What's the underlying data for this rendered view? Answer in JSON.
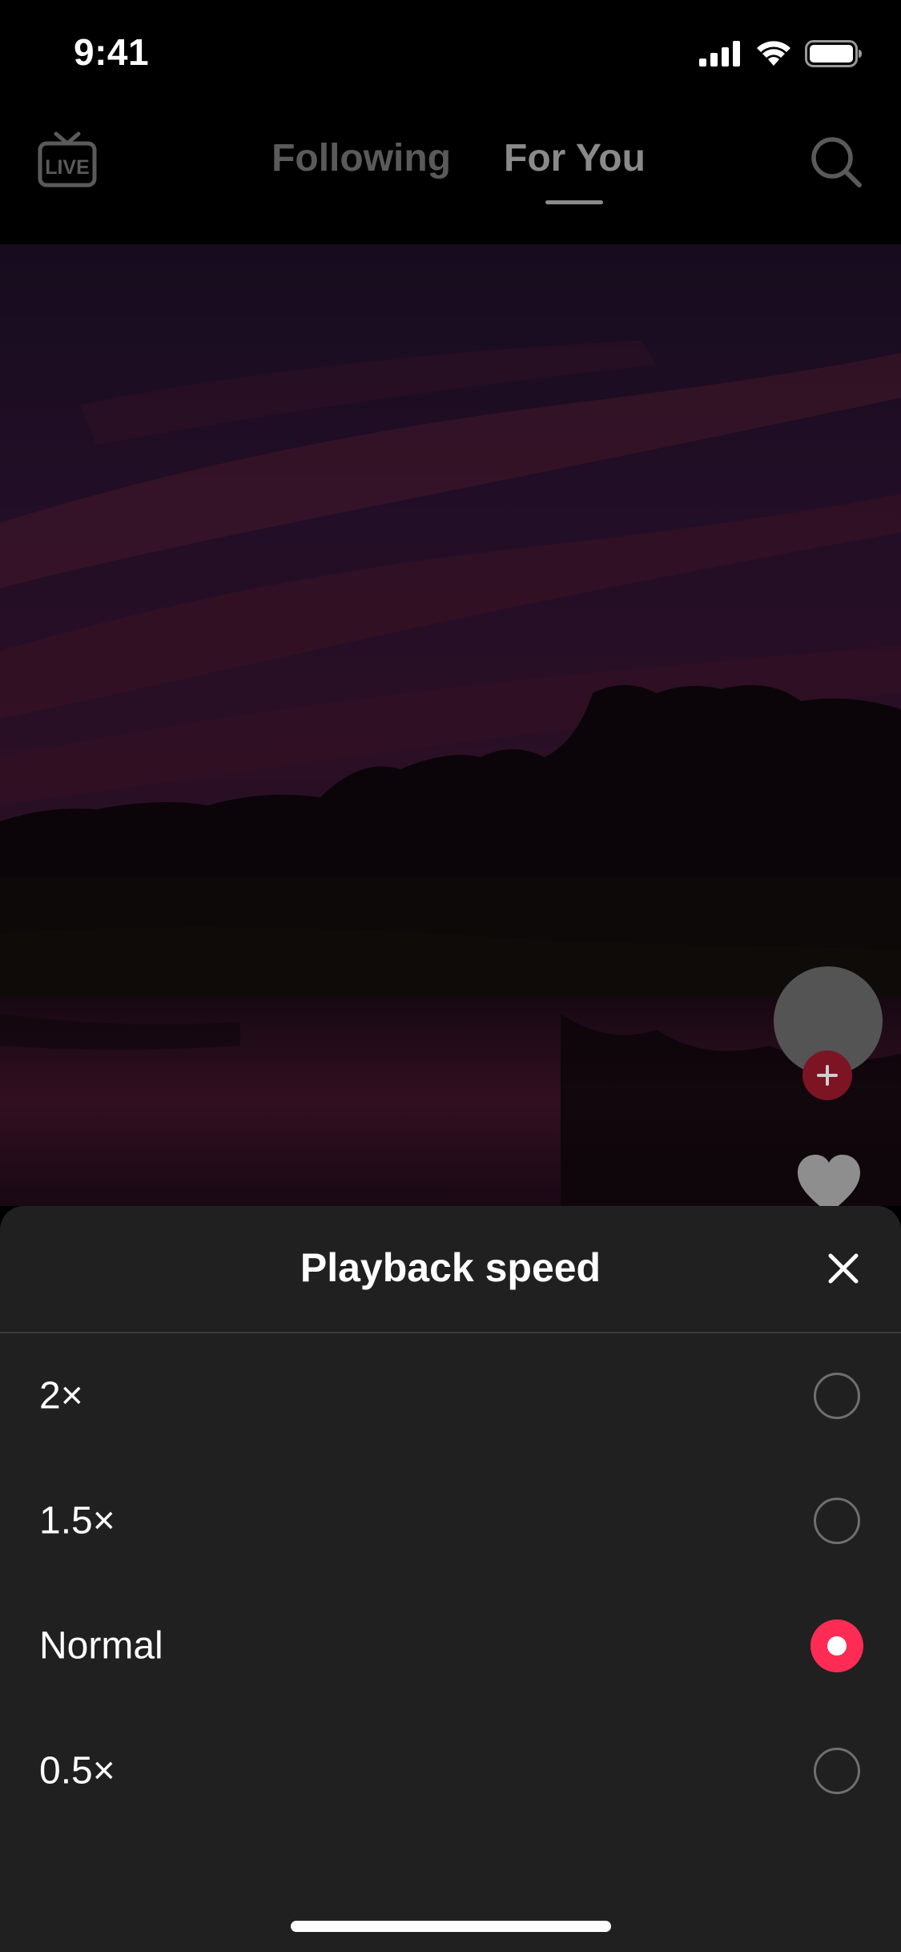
{
  "status_bar": {
    "time": "9:41"
  },
  "top_nav": {
    "live_label": "LIVE",
    "tabs": [
      {
        "label": "Following",
        "active": false
      },
      {
        "label": "For You",
        "active": true
      }
    ]
  },
  "sheet": {
    "title": "Playback speed",
    "options": [
      {
        "label": "2×",
        "selected": false
      },
      {
        "label": "1.5×",
        "selected": false
      },
      {
        "label": "Normal",
        "selected": true
      },
      {
        "label": "0.5×",
        "selected": false
      }
    ]
  },
  "colors": {
    "accent": "#fe2c55",
    "sheet_background": "#202020",
    "app_background": "#000000"
  },
  "icons": {
    "live": "live-tv-icon",
    "search": "search-icon",
    "close": "close-icon",
    "like": "heart-icon",
    "follow": "plus-icon"
  }
}
